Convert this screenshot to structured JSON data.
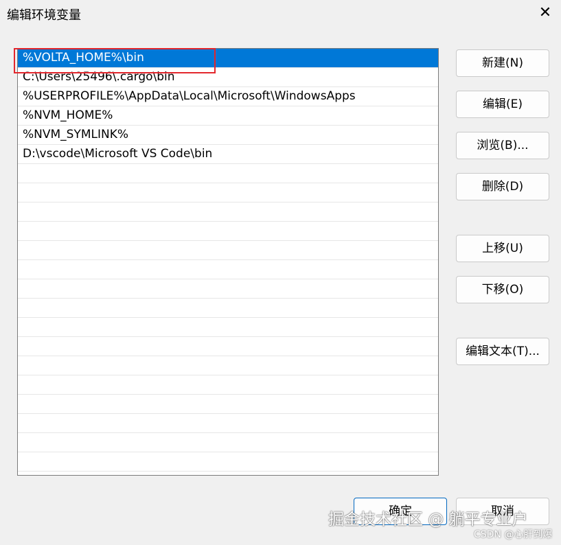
{
  "window": {
    "title": "编辑环境变量",
    "close_glyph": "✕"
  },
  "list": {
    "items": [
      {
        "text": "%VOLTA_HOME%\\bin",
        "selected": true
      },
      {
        "text": "C:\\Users\\25496\\.cargo\\bin"
      },
      {
        "text": "%USERPROFILE%\\AppData\\Local\\Microsoft\\WindowsApps"
      },
      {
        "text": "%NVM_HOME%"
      },
      {
        "text": "%NVM_SYMLINK%"
      },
      {
        "text": "D:\\vscode\\Microsoft VS Code\\bin"
      }
    ],
    "empty_rows": 16
  },
  "buttons": {
    "new": "新建(N)",
    "edit": "编辑(E)",
    "browse": "浏览(B)...",
    "delete": "删除(D)",
    "up": "上移(U)",
    "down": "下移(O)",
    "edit_text": "编辑文本(T)...",
    "ok": "确定",
    "cancel": "取消"
  },
  "watermark": {
    "main": "掘金技术社区 @ 躺平专业户",
    "sub": "CSDN @心肝到爆"
  },
  "colors": {
    "selection": "#0078d7",
    "highlight_box": "#e3262c"
  }
}
